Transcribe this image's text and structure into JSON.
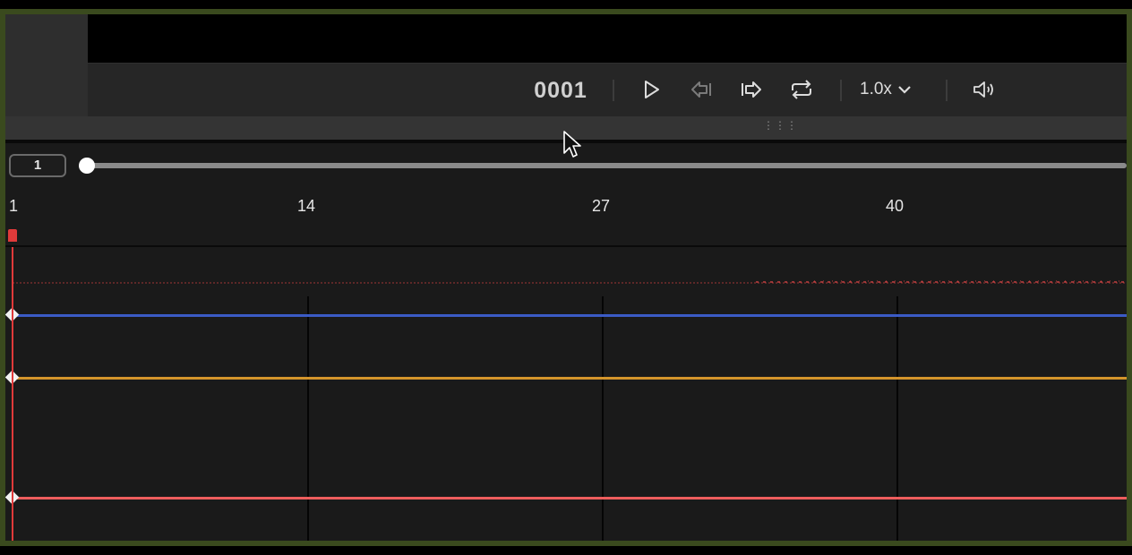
{
  "toolbar": {
    "frame_counter": "0001",
    "speed_label": "1.0x",
    "icons": [
      "play-icon",
      "step-back-icon",
      "step-forward-icon",
      "loop-icon",
      "chevron-down-icon",
      "volume-icon"
    ]
  },
  "scrubber": {
    "current_frame": "1",
    "position": 0.0
  },
  "ruler": {
    "labels": [
      "1",
      "14",
      "27",
      "40"
    ]
  },
  "curves": [
    {
      "color": "#3b5bc6"
    },
    {
      "color": "#d4952b"
    },
    {
      "color": "#ee5d5d"
    }
  ],
  "colors": {
    "playhead": "#e03a3a",
    "frame_border": "#3a4a1e"
  }
}
